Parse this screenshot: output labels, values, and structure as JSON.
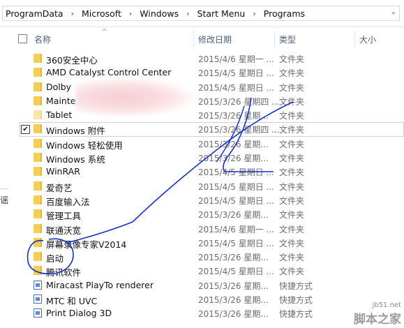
{
  "breadcrumb": [
    "ProgramData",
    "Microsoft",
    "Windows",
    "Start Menu",
    "Programs"
  ],
  "columns": {
    "name": "名称",
    "date": "修改日期",
    "type": "类型",
    "size": "大小"
  },
  "left_edge_text": "谣",
  "rows": [
    {
      "name": "360安全中心",
      "date": "2015/4/6 星期一 ...",
      "type": "文件夹",
      "icon": "folder"
    },
    {
      "name": "AMD Catalyst Control Center",
      "date": "2015/4/5 星期日 ...",
      "type": "文件夹",
      "icon": "folder"
    },
    {
      "name": "Dolby",
      "date": "2015/4/5 星期日 ...",
      "type": "文件夹",
      "icon": "folder"
    },
    {
      "name": "Mainte",
      "date": "2015/3/26 星期四 ...",
      "type": "文件夹",
      "icon": "folder"
    },
    {
      "name": "Tablet",
      "date": "2015/3/26 星期...",
      "type": "文件夹",
      "icon": "folder-light"
    },
    {
      "name": "Windows 附件",
      "date": "2015/3/26 星期四 ...",
      "type": "文件夹",
      "icon": "folder",
      "checked": true
    },
    {
      "name": "Windows 轻松使用",
      "date": "2015/3/26 星期...",
      "type": "文件夹",
      "icon": "folder"
    },
    {
      "name": "Windows 系统",
      "date": "2015/3/26 星期...",
      "type": "文件夹",
      "icon": "folder"
    },
    {
      "name": "WinRAR",
      "date": "2015/4/5 星期日 ...",
      "type": "文件夹",
      "icon": "folder"
    },
    {
      "name": "爱奇艺",
      "date": "2015/4/5 星期日 ...",
      "type": "文件夹",
      "icon": "folder"
    },
    {
      "name": "百度输入法",
      "date": "2015/4/5 星期日 ...",
      "type": "文件夹",
      "icon": "folder"
    },
    {
      "name": "管理工具",
      "date": "2015/3/26 星期...",
      "type": "文件夹",
      "icon": "folder"
    },
    {
      "name": "联通沃宽",
      "date": "2015/4/6 星期一 ...",
      "type": "文件夹",
      "icon": "folder"
    },
    {
      "name": "屏幕录像专家V2014",
      "date": "2015/4/5 星期日 ...",
      "type": "文件夹",
      "icon": "folder"
    },
    {
      "name": "启动",
      "date": "2015/3/26 星期...",
      "type": "文件夹",
      "icon": "folder"
    },
    {
      "name": "腾讯软件",
      "date": "2015/4/5 星期日 ...",
      "type": "文件夹",
      "icon": "folder"
    },
    {
      "name": "Miracast PlayTo renderer",
      "date": "2015/3/26 星期...",
      "type": "快捷方式",
      "icon": "app"
    },
    {
      "name": "MTC 和 UVC",
      "date": "2015/3/26 星期...",
      "type": "快捷方式",
      "icon": "app"
    },
    {
      "name": "Print Dialog 3D",
      "date": "2015/3/26 星期...",
      "type": "快捷方式",
      "icon": "app"
    }
  ],
  "watermark": {
    "site": "jb51.net",
    "brand": "脚本之家"
  }
}
